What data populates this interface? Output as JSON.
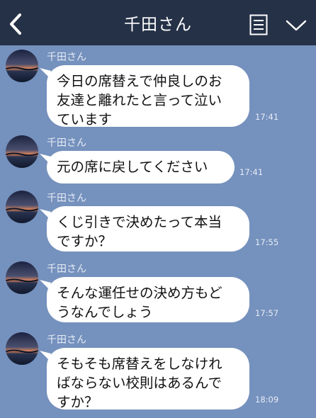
{
  "header": {
    "title": "千田さん"
  },
  "messages": [
    {
      "sender": "千田さん",
      "text": "今日の席替えで仲良しのお\n友達と離れたと言って泣い\nています",
      "time": "17:41"
    },
    {
      "sender": "千田さん",
      "text": "元の席に戻してください",
      "time": "17:41"
    },
    {
      "sender": "千田さん",
      "text": "くじ引きで決めたって本当\nですか？",
      "time": "17:55"
    },
    {
      "sender": "千田さん",
      "text": "そんな運任せの決め方もど\nうなんでしょう",
      "time": "17:57"
    },
    {
      "sender": "千田さん",
      "text": "そもそも席替えをしなけれ\nばならない校則はあるんで\nすか？",
      "time": "18:09"
    }
  ],
  "colors": {
    "header_bg": "#253147",
    "chat_bg": "#7591bd",
    "bubble_bg": "#ffffff"
  },
  "icons": [
    "back-chevron-icon",
    "note-list-icon",
    "chevron-down-icon"
  ]
}
